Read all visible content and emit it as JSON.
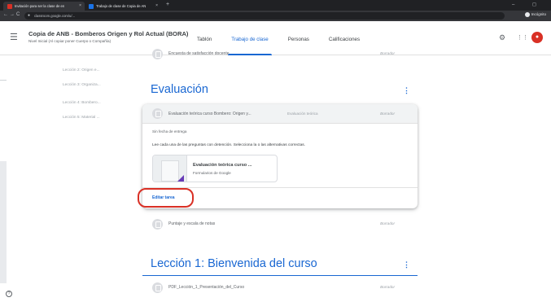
{
  "browser": {
    "tabs": [
      {
        "title": "Invitación para ser la clase de en",
        "close": "×",
        "favicon_color": "#d93025"
      },
      {
        "title": "Trabajo de clase de Copia de AN",
        "close": "×",
        "favicon_color": "#1a73e8"
      }
    ],
    "new_tab": "+",
    "window_controls": "–  ◻",
    "nav": {
      "back": "←",
      "forward": "→",
      "reload": "C"
    },
    "url": "classroom.google.com/u/...",
    "profile_label": "Incógnito"
  },
  "header": {
    "menu_icon": "☰",
    "course_title": "Copia de ANB - Bomberos Origen y Rol Actual (BORA)",
    "course_subtitle": "Nivel Inicial (Al copiar poner Cuerpo o Compañía)",
    "tabs": [
      "Tablón",
      "Trabajo de clase",
      "Personas",
      "Calificaciones"
    ],
    "active_tab": "Trabajo de clase",
    "settings_icon": "⚙",
    "apps_icon": "⋮⋮",
    "avatar_initial": "●"
  },
  "sidebar": {
    "items": [
      "Lección 2: Origen e...",
      "Lección 3: Organiza...",
      "Lección 4: Bombero...",
      "Lección 5: Material ..."
    ],
    "help_icon": "?"
  },
  "main": {
    "top_item": {
      "title": "Encuesta de satisfacción docente",
      "status": "Borrador"
    },
    "sections": [
      {
        "title": "Evaluación",
        "menu": "⋮"
      },
      {
        "title": "Lección 1: Bienvenida del curso",
        "menu": "⋮"
      }
    ],
    "expanded_card": {
      "title": "Evaluación teórica curso Bombero: Origen y...",
      "category": "Evaluación teórica",
      "status": "Borrador",
      "due": "Sin fecha de entrega",
      "instructions": "Lee cada una de las preguntas con detención. Selecciona la o las alternativas correctas.",
      "attachment": {
        "title": "Evaluación teórica curso ...",
        "subtitle": "Formularios de Google"
      },
      "edit_label": "Editar tarea"
    },
    "score_item": {
      "title": "Puntaje y escala de notas",
      "status": "Borrador"
    },
    "lesson_item": {
      "title": "PDF_Lección_1_Presentación_del_Curso",
      "status": "Borrador"
    }
  },
  "colors": {
    "accent": "#1967d2",
    "highlight": "#d93025"
  }
}
